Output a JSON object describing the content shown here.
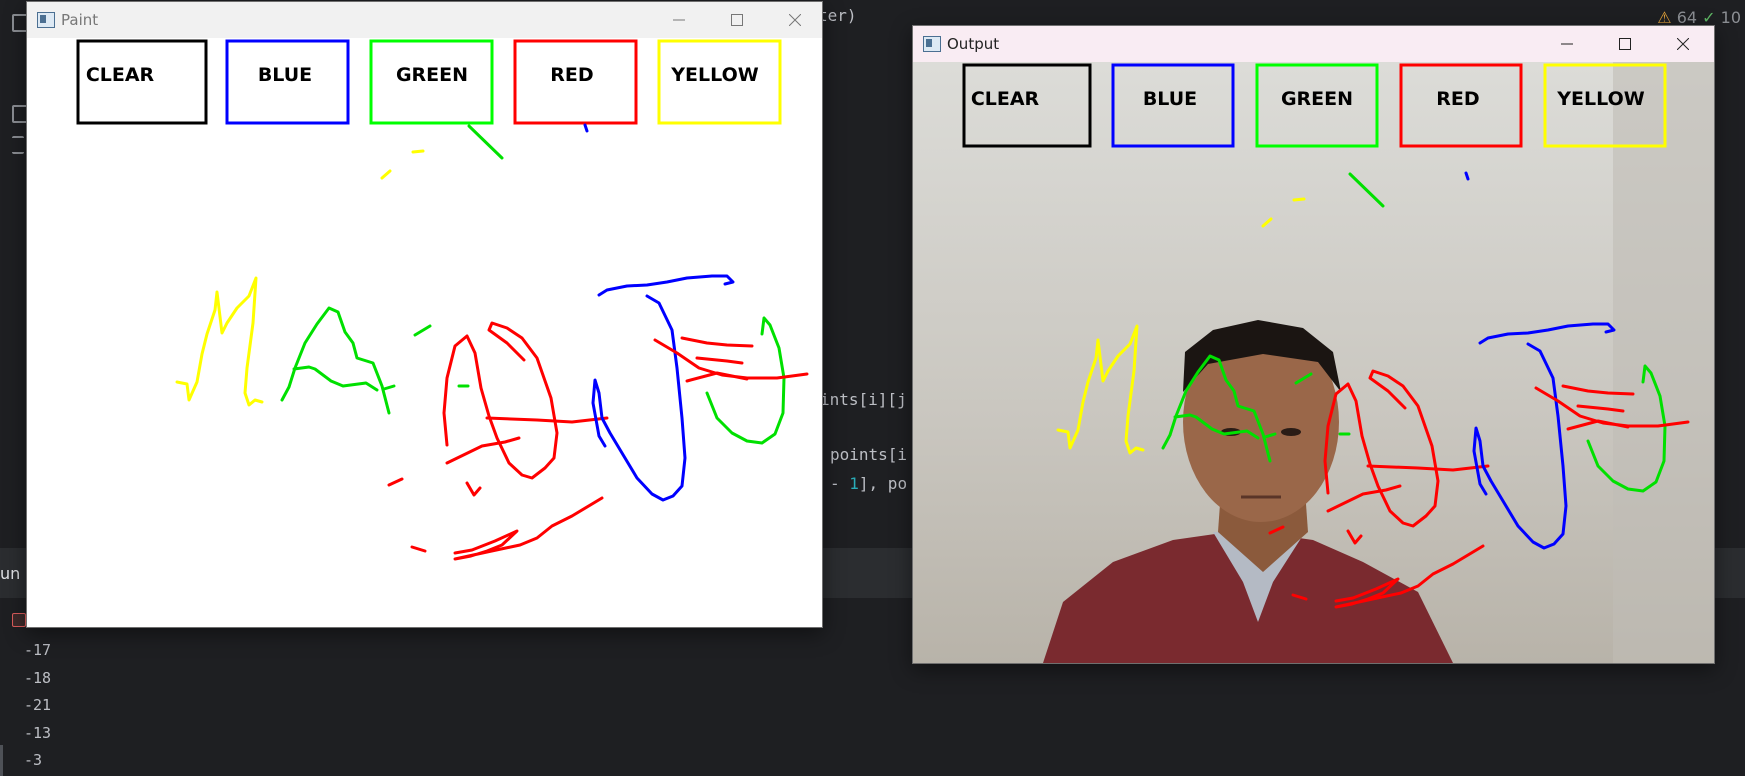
{
  "ide": {
    "code_fragments": [
      "ter)",
      "ints[i][j",
      "points[i",
      "- ",
      "1",
      "], po"
    ],
    "warnings": "64",
    "checks": "10",
    "run_label": "un",
    "console_lines": [
      "-17",
      "-18",
      "-21",
      "-13",
      "-3"
    ]
  },
  "paint_window": {
    "title": "Paint"
  },
  "output_window": {
    "title": "Output"
  },
  "buttons": [
    {
      "label": "CLEAR",
      "color": "#000000"
    },
    {
      "label": "BLUE",
      "color": "#0000ff"
    },
    {
      "label": "GREEN",
      "color": "#00ff00"
    },
    {
      "label": "RED",
      "color": "#ff0000"
    },
    {
      "label": "YELLOW",
      "color": "#ffff00"
    }
  ],
  "colors": {
    "yellow": "#ffff00",
    "green": "#00e000",
    "red": "#ff0000",
    "blue": "#0000ff"
  }
}
